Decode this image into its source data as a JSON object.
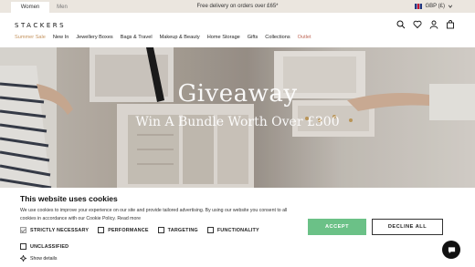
{
  "topbar": {
    "tabs": [
      "Women",
      "Men"
    ],
    "promo": "Free delivery on orders over £65*",
    "currency": "GBP (£)"
  },
  "header": {
    "logo": "STACKERS",
    "nav": [
      "Summer Sale",
      "New In",
      "Jewellery Boxes",
      "Bags & Travel",
      "Makeup & Beauty",
      "Home Storage",
      "Gifts",
      "Collections",
      "Outlet"
    ],
    "icons": [
      "search-icon",
      "heart-icon",
      "account-icon",
      "bag-icon"
    ]
  },
  "hero": {
    "title": "Giveaway",
    "subtitle": "Win A Bundle Worth Over £300"
  },
  "cookie": {
    "title": "This website uses cookies",
    "text": "We use cookies to improve your experience on our site and provide tailored advertising. By using our website you consent to all cookies in accordance with our Cookie Policy.",
    "read_more": "Read more",
    "options": [
      "STRICTLY NECESSARY",
      "PERFORMANCE",
      "TARGETING",
      "FUNCTIONALITY"
    ],
    "unclassified": "UNCLASSIFIED",
    "show_details": "Show details",
    "accept": "ACCEPT",
    "decline": "DECLINE ALL"
  },
  "colors": {
    "accent_green": "#6bc187",
    "sale": "#c4935e",
    "outlet": "#c06a5a",
    "topbar": "#ebe6df"
  }
}
